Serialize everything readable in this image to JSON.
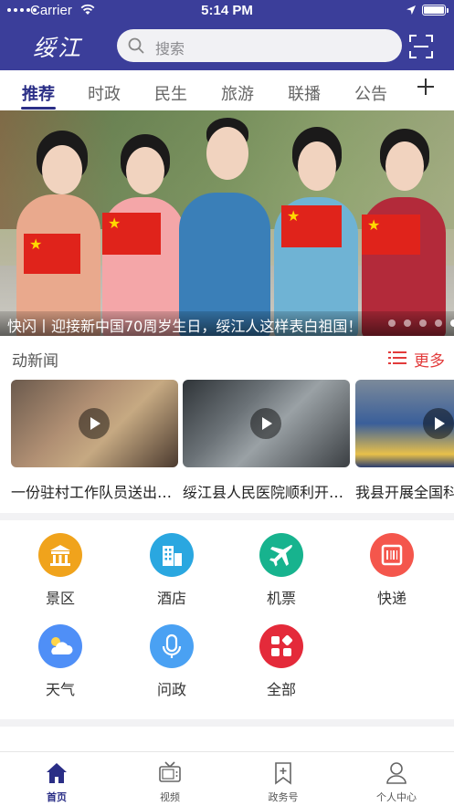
{
  "status_bar": {
    "carrier": "Carrier",
    "time": "5:14 PM"
  },
  "header": {
    "logo_text": "绥江",
    "search_placeholder": "搜索"
  },
  "tabs": [
    {
      "label": "推荐",
      "active": true
    },
    {
      "label": "时政"
    },
    {
      "label": "民生"
    },
    {
      "label": "旅游"
    },
    {
      "label": "联播"
    },
    {
      "label": "公告"
    }
  ],
  "banner": {
    "caption": "快闪丨迎接新中国70周岁生日，绥江人这样表白祖国！",
    "page_count": 5,
    "active_page": 5
  },
  "news_section": {
    "title": "动新闻",
    "more_label": "更多"
  },
  "videos": [
    {
      "title": "一份驻村工作队员送出的礼物"
    },
    {
      "title": "绥江县人民医院顺利开展远程会诊"
    },
    {
      "title": "我县开展全国科普日活动"
    }
  ],
  "services": [
    {
      "label": "景区",
      "icon": "scenic-temple-icon",
      "color": "#f0a31c"
    },
    {
      "label": "酒店",
      "icon": "hotel-building-icon",
      "color": "#2aa7e0"
    },
    {
      "label": "机票",
      "icon": "airplane-icon",
      "color": "#17b38e"
    },
    {
      "label": "快递",
      "icon": "express-box-icon",
      "color": "#f4564c"
    },
    {
      "label": "天气",
      "icon": "weather-cloud-icon",
      "color": "#4f8ff7"
    },
    {
      "label": "问政",
      "icon": "microphone-icon",
      "color": "#4aa1f3"
    },
    {
      "label": "全部",
      "icon": "all-apps-icon",
      "color": "#e42a3a"
    }
  ],
  "tab_bar": [
    {
      "label": "首页",
      "icon": "home-icon",
      "active": true
    },
    {
      "label": "视频",
      "icon": "tv-icon"
    },
    {
      "label": "政务号",
      "icon": "bookmark-plus-icon"
    },
    {
      "label": "个人中心",
      "icon": "user-icon"
    }
  ],
  "colors": {
    "brand": "#3b3e9a",
    "active_tab": "#2a2e86",
    "accent_red": "#e23b3b"
  }
}
